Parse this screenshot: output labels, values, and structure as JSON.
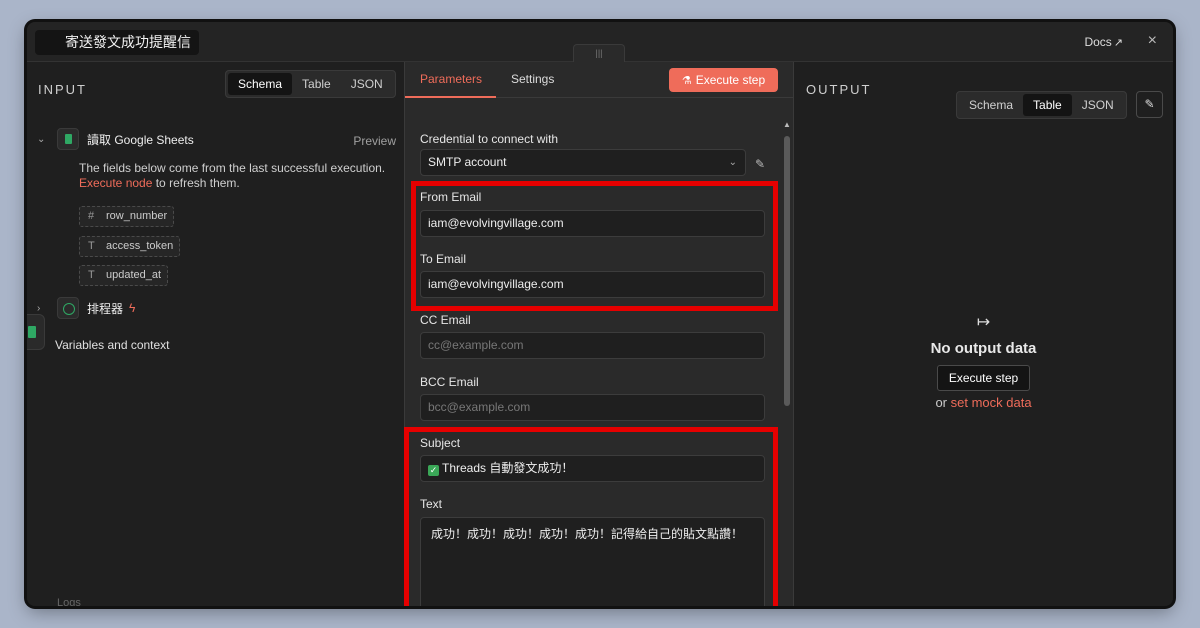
{
  "window": {
    "title": "寄送發文成功提醒信",
    "docs_label": "Docs",
    "close_icon": "×",
    "accent_color": "#ef6c5a",
    "highlight_color": "#e60000"
  },
  "input": {
    "label": "INPUT",
    "view_tabs": [
      "Schema",
      "Table",
      "JSON"
    ],
    "active_view": "Schema",
    "node": {
      "name": "讀取 Google Sheets",
      "preview_label": "Preview"
    },
    "note_text": "The fields below come from the last successful execution.",
    "note_link": "Execute node",
    "note_suffix": " to refresh them.",
    "fields": [
      {
        "type_icon": "#",
        "name": "row_number"
      },
      {
        "type_icon": "T",
        "name": "access_token"
      },
      {
        "type_icon": "T",
        "name": "updated_at"
      }
    ],
    "trigger_node": "排程器",
    "variables_label": "Variables and context",
    "logs_label": "Logs"
  },
  "params": {
    "tabs": [
      "Parameters",
      "Settings"
    ],
    "active_tab": "Parameters",
    "execute_label": "Execute step",
    "credential_label": "Credential to connect with",
    "credential_value": "SMTP account",
    "from_label": "From Email",
    "from_value": "iam@evolvingvillage.com",
    "to_label": "To Email",
    "to_value": "iam@evolvingvillage.com",
    "cc_label": "CC Email",
    "cc_placeholder": "cc@example.com",
    "bcc_label": "BCC Email",
    "bcc_placeholder": "bcc@example.com",
    "subject_label": "Subject",
    "subject_value": "Threads 自動發文成功！",
    "text_label": "Text",
    "text_value": "成功！成功！成功！成功！成功！記得給自己的貼文點讚！"
  },
  "output": {
    "label": "OUTPUT",
    "view_tabs": [
      "Schema",
      "Table",
      "JSON"
    ],
    "active_view": "Table",
    "empty_title": "No output data",
    "execute_label": "Execute step",
    "mock_prefix": "or",
    "mock_link": "set mock data"
  }
}
